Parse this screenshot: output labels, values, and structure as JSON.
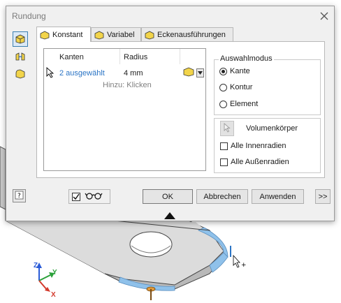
{
  "dialog": {
    "title": "Rundung",
    "tabs": [
      {
        "label": "Konstant"
      },
      {
        "label": "Variabel"
      },
      {
        "label": "Eckenausführungen"
      }
    ],
    "table": {
      "col_edges": "Kanten",
      "col_radius": "Radius",
      "row_edges": "2 ausgewählt",
      "row_radius": "4 mm",
      "hint": "Hinzu: Klicken"
    },
    "selection_mode": {
      "label": "Auswahlmodus",
      "options": [
        {
          "label": "Kante",
          "selected": true
        },
        {
          "label": "Kontur",
          "selected": false
        },
        {
          "label": "Element",
          "selected": false
        }
      ]
    },
    "solid_label": "Volumenkörper",
    "checkboxes": [
      {
        "label": "Alle Innenradien",
        "checked": false
      },
      {
        "label": "Alle Außenradien",
        "checked": false
      }
    ],
    "preview_checked": true,
    "buttons": {
      "ok": "OK",
      "cancel": "Abbrechen",
      "apply": "Anwenden",
      "more": ">>"
    }
  },
  "axes": {
    "x": "X",
    "y": "Y",
    "z": "Z"
  },
  "colors": {
    "accent": "#2a74c5",
    "part_face": "#d8d8d8",
    "highlight_edge": "#8fc1ea",
    "axis_x": "#d33a2c",
    "axis_y": "#2aa13a",
    "axis_z": "#2a5bd7"
  }
}
